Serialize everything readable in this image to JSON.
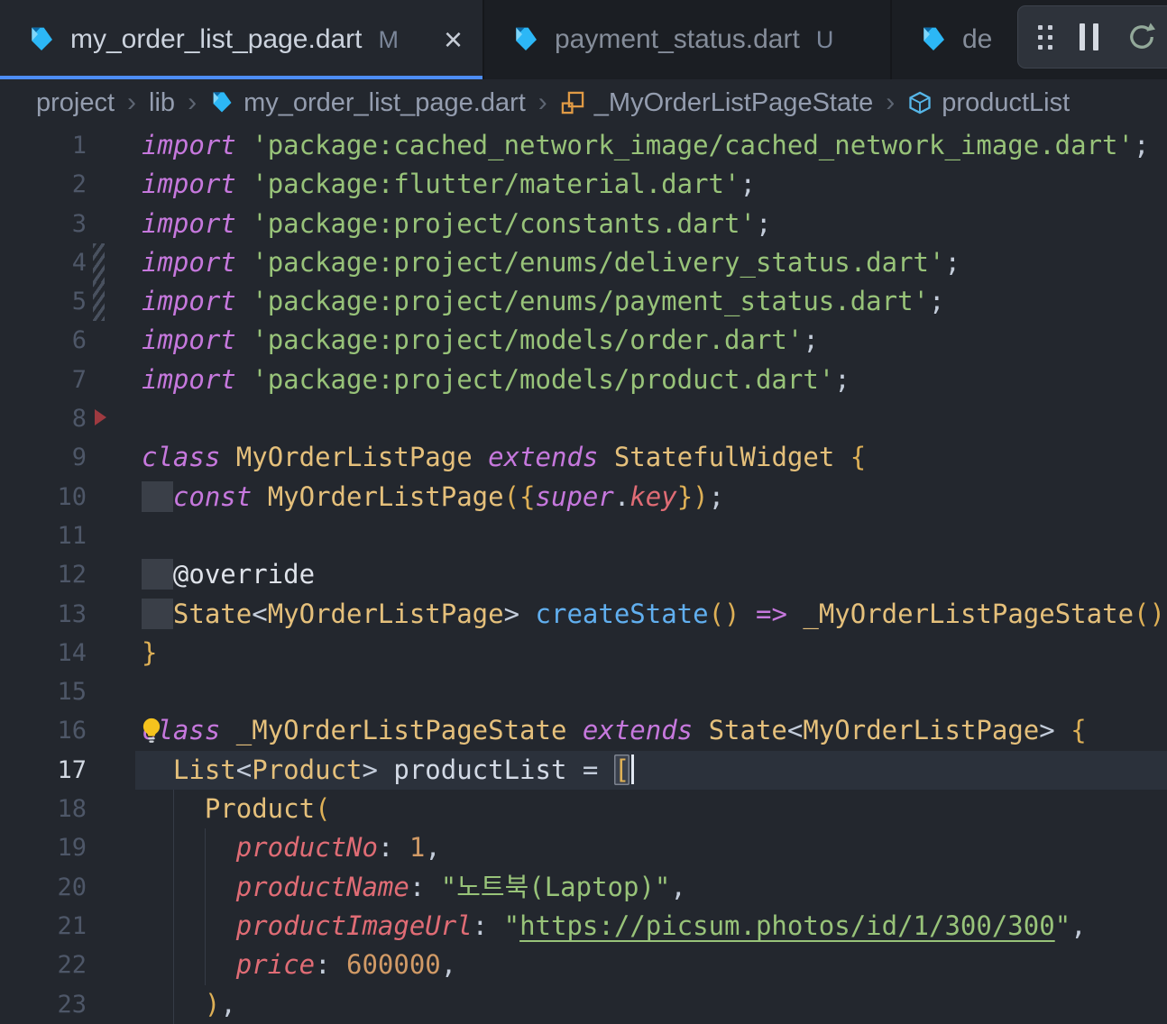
{
  "colors": {
    "accent_blue": "#4d8df6",
    "editor_bg": "#23272e",
    "tab_bar_bg": "#1b1e23",
    "bulb_yellow": "#f5c31d"
  },
  "tabs": [
    {
      "icon": "dart-icon",
      "label": "my_order_list_page.dart",
      "badge": "M",
      "close_glyph": "×",
      "active": true
    },
    {
      "icon": "dart-icon",
      "label": "payment_status.dart",
      "badge": "U",
      "active": false
    },
    {
      "icon": "dart-icon",
      "label": "de",
      "badge": "",
      "active": false
    }
  ],
  "debug_toolbar": {
    "buttons": [
      "grip-handle",
      "pause",
      "restart"
    ]
  },
  "breadcrumb": {
    "separator": "›",
    "items": [
      {
        "icon": null,
        "label": "project"
      },
      {
        "icon": null,
        "label": "lib"
      },
      {
        "icon": "dart-icon",
        "label": "my_order_list_page.dart"
      },
      {
        "icon": "class-symbol-icon",
        "label": "_MyOrderListPageState"
      },
      {
        "icon": "field-symbol-icon",
        "label": "productList"
      }
    ]
  },
  "editor": {
    "current_line": 17,
    "lines": [
      {
        "n": 1,
        "tokens": [
          [
            "kw",
            "import"
          ],
          [
            "pl",
            " "
          ],
          [
            "str",
            "'package:cached_network_image/cached_network_image.dart'"
          ],
          [
            "pl",
            ";"
          ]
        ]
      },
      {
        "n": 2,
        "tokens": [
          [
            "kw",
            "import"
          ],
          [
            "pl",
            " "
          ],
          [
            "str",
            "'package:flutter/material.dart'"
          ],
          [
            "pl",
            ";"
          ]
        ]
      },
      {
        "n": 3,
        "tokens": [
          [
            "kw",
            "import"
          ],
          [
            "pl",
            " "
          ],
          [
            "str",
            "'package:project/constants.dart'"
          ],
          [
            "pl",
            ";"
          ]
        ]
      },
      {
        "n": 4,
        "deco": "stripes",
        "tokens": [
          [
            "kw",
            "import"
          ],
          [
            "pl",
            " "
          ],
          [
            "str",
            "'package:project/enums/delivery_status.dart'"
          ],
          [
            "pl",
            ";"
          ]
        ]
      },
      {
        "n": 5,
        "deco": "stripes",
        "tokens": [
          [
            "kw",
            "import"
          ],
          [
            "pl",
            " "
          ],
          [
            "str",
            "'package:project/enums/payment_status.dart'"
          ],
          [
            "pl",
            ";"
          ]
        ]
      },
      {
        "n": 6,
        "tokens": [
          [
            "kw",
            "import"
          ],
          [
            "pl",
            " "
          ],
          [
            "str",
            "'package:project/models/order.dart'"
          ],
          [
            "pl",
            ";"
          ]
        ]
      },
      {
        "n": 7,
        "tokens": [
          [
            "kw",
            "import"
          ],
          [
            "pl",
            " "
          ],
          [
            "str",
            "'package:project/models/product.dart'"
          ],
          [
            "pl",
            ";"
          ]
        ]
      },
      {
        "n": 8,
        "deco": "triangle",
        "tokens": []
      },
      {
        "n": 9,
        "tokens": [
          [
            "kw",
            "class"
          ],
          [
            "pl",
            " "
          ],
          [
            "type",
            "MyOrderListPage"
          ],
          [
            "pl",
            " "
          ],
          [
            "kw",
            "extends"
          ],
          [
            "pl",
            " "
          ],
          [
            "type",
            "StatefulWidget"
          ],
          [
            "pl",
            " "
          ],
          [
            "br",
            "{"
          ]
        ]
      },
      {
        "n": 10,
        "tokens": [
          [
            "wsb",
            "  "
          ],
          [
            "kw",
            "const"
          ],
          [
            "pl",
            " "
          ],
          [
            "type",
            "MyOrderListPage"
          ],
          [
            "br",
            "({"
          ],
          [
            "kw",
            "super"
          ],
          [
            "pl",
            "."
          ],
          [
            "prop",
            "key"
          ],
          [
            "br",
            "})"
          ],
          [
            "pl",
            ";"
          ]
        ]
      },
      {
        "n": 11,
        "tokens": []
      },
      {
        "n": 12,
        "tokens": [
          [
            "wsb",
            "  "
          ],
          [
            "at",
            "@override"
          ]
        ]
      },
      {
        "n": 13,
        "tokens": [
          [
            "wsb",
            "  "
          ],
          [
            "type",
            "State"
          ],
          [
            "pl",
            "<"
          ],
          [
            "type",
            "MyOrderListPage"
          ],
          [
            "pl",
            "> "
          ],
          [
            "fn",
            "createState"
          ],
          [
            "br",
            "()"
          ],
          [
            "pl",
            " "
          ],
          [
            "op",
            "=>"
          ],
          [
            "pl",
            " "
          ],
          [
            "type",
            "_MyOrderListPageState"
          ],
          [
            "br",
            "()"
          ],
          [
            "pl",
            ";"
          ]
        ]
      },
      {
        "n": 14,
        "tokens": [
          [
            "br",
            "}"
          ]
        ]
      },
      {
        "n": 15,
        "tokens": []
      },
      {
        "n": 16,
        "bulb": true,
        "tokens": [
          [
            "kw",
            "class"
          ],
          [
            "pl",
            " "
          ],
          [
            "type",
            "_MyOrderListPageState"
          ],
          [
            "pl",
            " "
          ],
          [
            "kw",
            "extends"
          ],
          [
            "pl",
            " "
          ],
          [
            "type",
            "State"
          ],
          [
            "pl",
            "<"
          ],
          [
            "type",
            "MyOrderListPage"
          ],
          [
            "pl",
            "> "
          ],
          [
            "br",
            "{"
          ]
        ]
      },
      {
        "n": 17,
        "current": true,
        "tokens": [
          [
            "pl",
            "  "
          ],
          [
            "type",
            "List"
          ],
          [
            "pl",
            "<"
          ],
          [
            "type",
            "Product"
          ],
          [
            "pl",
            "> "
          ],
          [
            "var",
            "productList"
          ],
          [
            "pl",
            " = "
          ],
          [
            "brm",
            "["
          ],
          [
            "cursor",
            ""
          ]
        ]
      },
      {
        "n": 18,
        "guides": [
          2
        ],
        "tokens": [
          [
            "pl",
            "    "
          ],
          [
            "type",
            "Product"
          ],
          [
            "br",
            "("
          ]
        ]
      },
      {
        "n": 19,
        "guides": [
          2,
          4
        ],
        "tokens": [
          [
            "pl",
            "      "
          ],
          [
            "prop",
            "productNo"
          ],
          [
            "pl",
            ": "
          ],
          [
            "num",
            "1"
          ],
          [
            "pl",
            ","
          ]
        ]
      },
      {
        "n": 20,
        "guides": [
          2,
          4
        ],
        "tokens": [
          [
            "pl",
            "      "
          ],
          [
            "prop",
            "productName"
          ],
          [
            "pl",
            ": "
          ],
          [
            "str",
            "\"노트북(Laptop)\""
          ],
          [
            "pl",
            ","
          ]
        ]
      },
      {
        "n": 21,
        "guides": [
          2,
          4
        ],
        "tokens": [
          [
            "pl",
            "      "
          ],
          [
            "prop",
            "productImageUrl"
          ],
          [
            "pl",
            ": "
          ],
          [
            "str",
            "\""
          ],
          [
            "strl",
            "https://picsum.photos/id/1/300/300"
          ],
          [
            "str",
            "\""
          ],
          [
            "pl",
            ","
          ]
        ]
      },
      {
        "n": 22,
        "guides": [
          2,
          4
        ],
        "tokens": [
          [
            "pl",
            "      "
          ],
          [
            "prop",
            "price"
          ],
          [
            "pl",
            ": "
          ],
          [
            "num",
            "600000"
          ],
          [
            "pl",
            ","
          ]
        ]
      },
      {
        "n": 23,
        "guides": [
          2
        ],
        "tokens": [
          [
            "pl",
            "    "
          ],
          [
            "br",
            ")"
          ],
          [
            "pl",
            ","
          ]
        ]
      }
    ]
  }
}
